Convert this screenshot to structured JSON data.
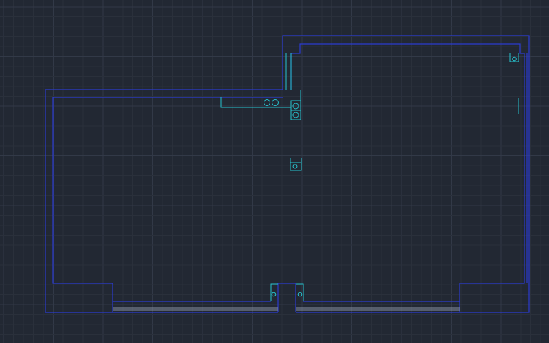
{
  "canvas": {
    "background": "#222833",
    "grid_minor_color": "#2a303b",
    "grid_major_color": "#323947"
  },
  "colors": {
    "walls": "#2b3bd0",
    "fixtures": "#27c3cf",
    "sill": "#8a93a6"
  },
  "layers": [
    {
      "name": "walls",
      "visible": true
    },
    {
      "name": "fixtures",
      "visible": true
    }
  ]
}
